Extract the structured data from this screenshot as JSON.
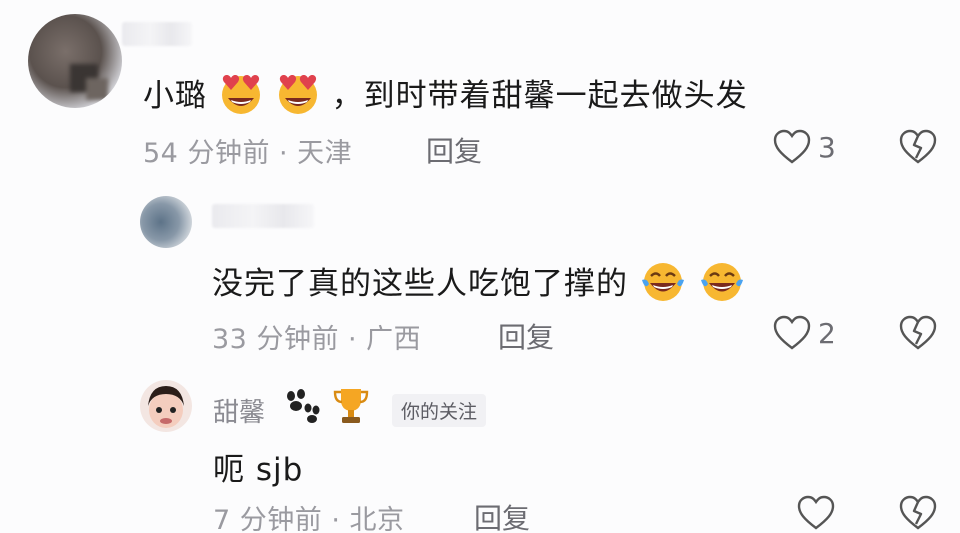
{
  "comments": [
    {
      "text_prefix": "小璐",
      "text_suffix": "，到时带着甜馨一起去做头发",
      "emojis": [
        "heart-eyes-emoji",
        "heart-eyes-emoji"
      ],
      "meta": "54 分钟前 · 天津",
      "reply_label": "回复",
      "like_count": "3"
    },
    {
      "text_prefix": "没完了真的这些人吃饱了撑的",
      "emojis": [
        "tears-of-joy-emoji",
        "tears-of-joy-emoji"
      ],
      "meta": "33 分钟前 · 广西",
      "reply_label": "回复",
      "like_count": "2"
    },
    {
      "username": "甜馨",
      "badges": [
        "paw-icon",
        "trophy-icon"
      ],
      "follow_badge": "你的关注",
      "text": "呃 sjb",
      "meta": "7 分钟前 · 北京",
      "reply_label": "回复"
    }
  ],
  "colors": {
    "text": "#1a1a1a",
    "meta": "#9a9aa0",
    "reply": "#6c6c72",
    "emoji_yellow": "#f7b731",
    "heart_red": "#e0414d"
  }
}
